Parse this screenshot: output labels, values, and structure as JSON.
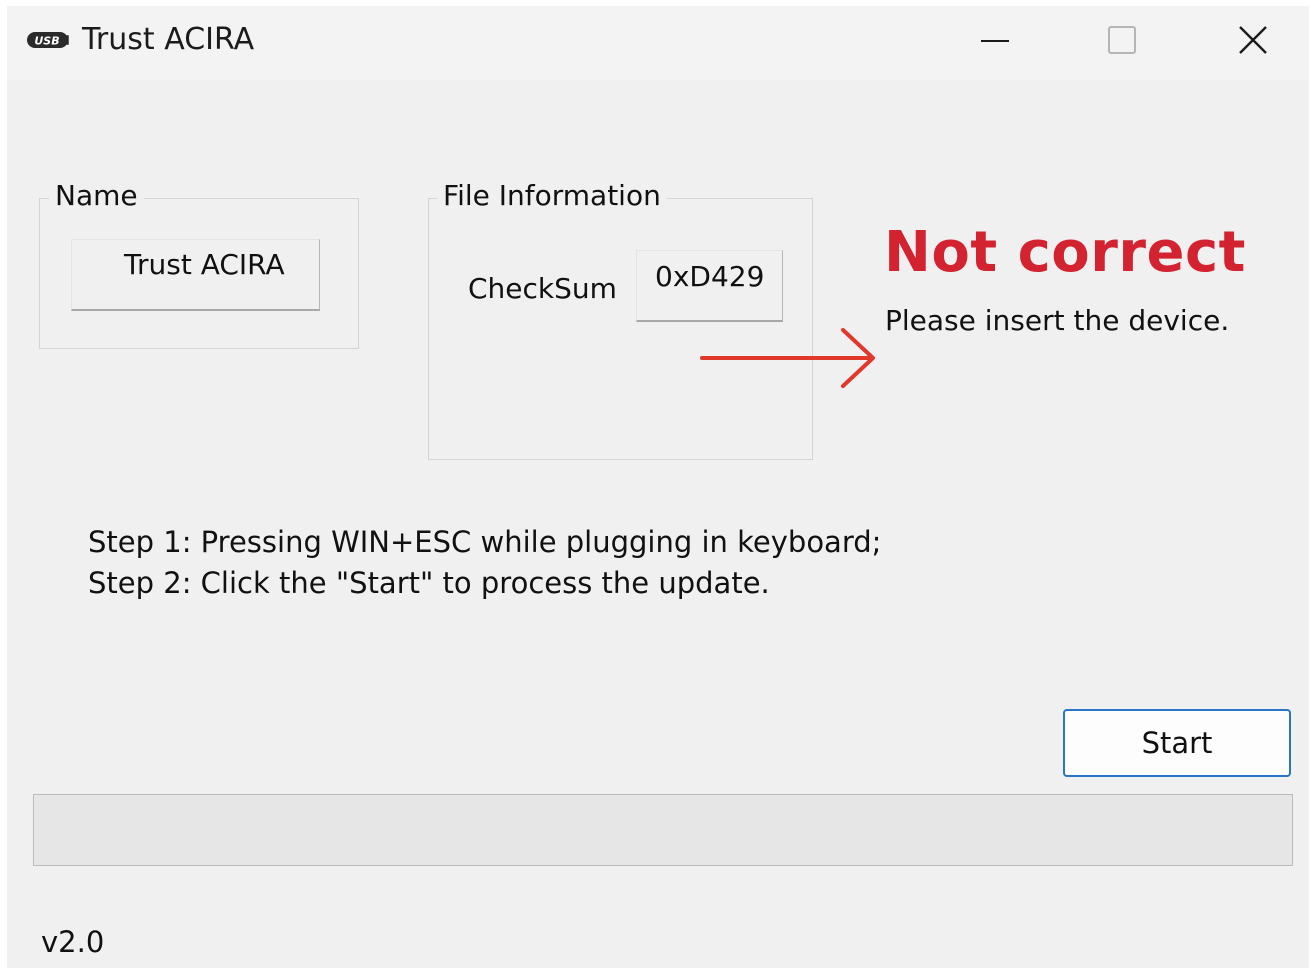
{
  "window": {
    "title": "Trust ACIRA",
    "icon": "usb-icon"
  },
  "name_group": {
    "legend": "Name",
    "value": "Trust ACIRA"
  },
  "file_group": {
    "legend": "File Information",
    "checksum_label": "CheckSum",
    "checksum_value": "0xD429"
  },
  "status": {
    "title": "Not correct",
    "message": "Please insert the device.",
    "color": "#d32230",
    "annotation_arrow": "red-arrow-icon"
  },
  "steps": [
    "Step 1: Pressing WIN+ESC while plugging in keyboard;",
    "Step 2: Click the \"Start\" to process the update."
  ],
  "start_button": {
    "label": "Start",
    "border_color": "#2a75c7"
  },
  "progress": {
    "value": 0
  },
  "version": "v2.0"
}
